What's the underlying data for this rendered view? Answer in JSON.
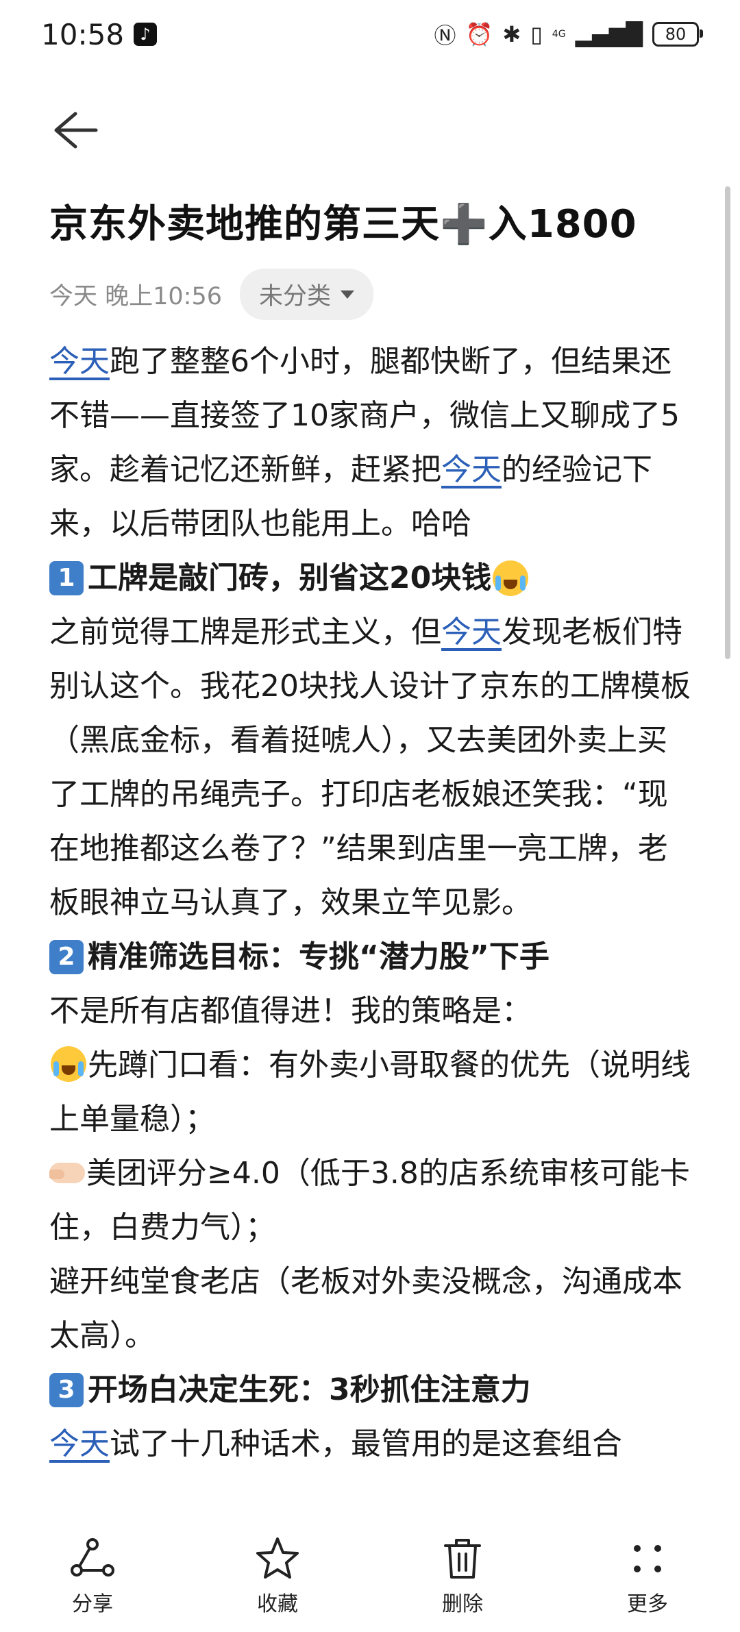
{
  "status_bar": {
    "time": "10:58",
    "app_icon": "tiktok-icon",
    "network": "4G",
    "battery": "80"
  },
  "note": {
    "title": "京东外卖地推的第三天➕入1800",
    "date": "今天 晚上10:56",
    "category": "未分类"
  },
  "content": {
    "p1": {
      "a": "今天",
      "b": "跑了整整6个小时，腿都快断了，但结果还不错——直接签了10家商户，微信上又聊成了5家。趁着记忆还新鲜，赶紧把",
      "c": "今天",
      "d": "的经验记下来，以后带团队也能用上。哈哈"
    },
    "s1": {
      "num": "1",
      "title": "工牌是敲门砖，别省这20块钱"
    },
    "p2": {
      "a": "之前觉得工牌是形式主义，但",
      "b": "今天",
      "c": "发现老板们特别认这个。我花20块找人设计了京东的工牌模板（黑底金标，看着挺唬人），又去美团外卖上买了工牌的吊绳壳子。打印店老板娘还笑我：“现在地推都这么卷了？”结果到店里一亮工牌，老板眼神立马认真了，效果立竿见影。"
    },
    "s2": {
      "num": "2",
      "title": "精准筛选目标：专挑“潜力股”下手"
    },
    "p3": "不是所有店都值得进！我的策略是：",
    "p4": "先蹲门口看：有外卖小哥取餐的优先（说明线上单量稳）；",
    "p5": "美团评分≥4.0（低于3.8的店系统审核可能卡住，白费力气）；",
    "p6": "避开纯堂食老店（老板对外卖没概念，沟通成本太高）。",
    "s3": {
      "num": "3",
      "title": "开场白决定生死：3秒抓住注意力"
    },
    "p7": {
      "a": "今天",
      "b": "试了十几种话术，最管用的是这套组合"
    }
  },
  "bottom_bar": {
    "share": "分享",
    "favorite": "收藏",
    "delete": "删除",
    "more": "更多"
  }
}
